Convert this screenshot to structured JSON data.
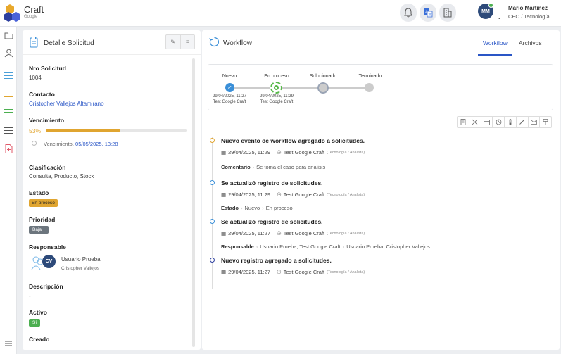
{
  "brand": {
    "title": "Craft",
    "subtitle": "Google"
  },
  "header_icons": [
    "bell-icon",
    "translate-icon",
    "building-icon"
  ],
  "user": {
    "initials": "MM",
    "name": "Mario Martinez",
    "role": "CEO / Tecnología"
  },
  "sidebar_icons": [
    "folder-icon",
    "user-icon",
    "ticket-icon",
    "ticket-icon",
    "ticket-icon",
    "ticket-icon",
    "document-add-icon",
    "menu-icon"
  ],
  "detail": {
    "title": "Detalle Solicitud",
    "nro_label": "Nro Solicitud",
    "nro_value": "1004",
    "contacto_label": "Contacto",
    "contacto_value": "Cristopher Vallejos Altamirano",
    "vencimiento_label": "Vencimiento",
    "progress_text": "53%",
    "progress_value": 0.53,
    "venc_prefix": "Vencimiento,",
    "venc_date": "05/05/2025, 13:28",
    "clasificacion_label": "Clasificación",
    "clasificacion_value": "Consulta, Producto, Stock",
    "estado_label": "Estado",
    "estado_value": "En proceso",
    "prioridad_label": "Prioridad",
    "prioridad_value": "Baja",
    "responsable_label": "Responsable",
    "responsable_initials": "CV",
    "responsable_name": "Usuario Prueba",
    "responsable_sub": "Cristopher Vallejos",
    "descripcion_label": "Descripción",
    "descripcion_value": "-",
    "activo_label": "Activo",
    "activo_value": "Sí",
    "creado_label": "Creado"
  },
  "workflow": {
    "title": "Workflow",
    "tabs": [
      "Workflow",
      "Archivos"
    ],
    "steps": [
      {
        "label": "Nuevo",
        "date": "29/04/2025, 11:27",
        "by": "Test Google Craft"
      },
      {
        "label": "En proceso",
        "date": "29/04/2025, 11:29",
        "by": "Test Google Craft"
      },
      {
        "label": "Solucionado",
        "date": "",
        "by": ""
      },
      {
        "label": "Terminado",
        "date": "",
        "by": ""
      }
    ],
    "events": [
      {
        "title": "Nuevo evento de workflow agregado a solicitudes.",
        "date": "29/04/2025, 11:29",
        "user": "Test Google Craft",
        "role": "(Tecnología / Analista)",
        "detail_label": "Comentario",
        "detail": [
          "Se toma el caso para analisis"
        ]
      },
      {
        "title": "Se actualizó registro de solicitudes.",
        "date": "29/04/2025, 11:29",
        "user": "Test Google Craft",
        "role": "(Tecnología / Analista)",
        "detail_label": "Estado",
        "detail": [
          "Nuevo",
          "En proceso"
        ]
      },
      {
        "title": "Se actualizó registro de solicitudes.",
        "date": "29/04/2025, 11:27",
        "user": "Test Google Craft",
        "role": "(Tecnología / Analista)",
        "detail_label": "Responsable",
        "detail": [
          "Usuario Prueba, Test Google Craft",
          "Usuario Prueba, Cristopher Vallejos"
        ]
      },
      {
        "title": "Nuevo registro agregado a solicitudes.",
        "date": "29/04/2025, 11:27",
        "user": "Test Google Craft",
        "role": "(Tecnología / Analista)",
        "detail_label": "",
        "detail": []
      }
    ]
  },
  "colors": {
    "accent": "#2a56c6",
    "warning": "#e0a530",
    "success": "#4caf50",
    "muted_badge": "#6c757d"
  }
}
